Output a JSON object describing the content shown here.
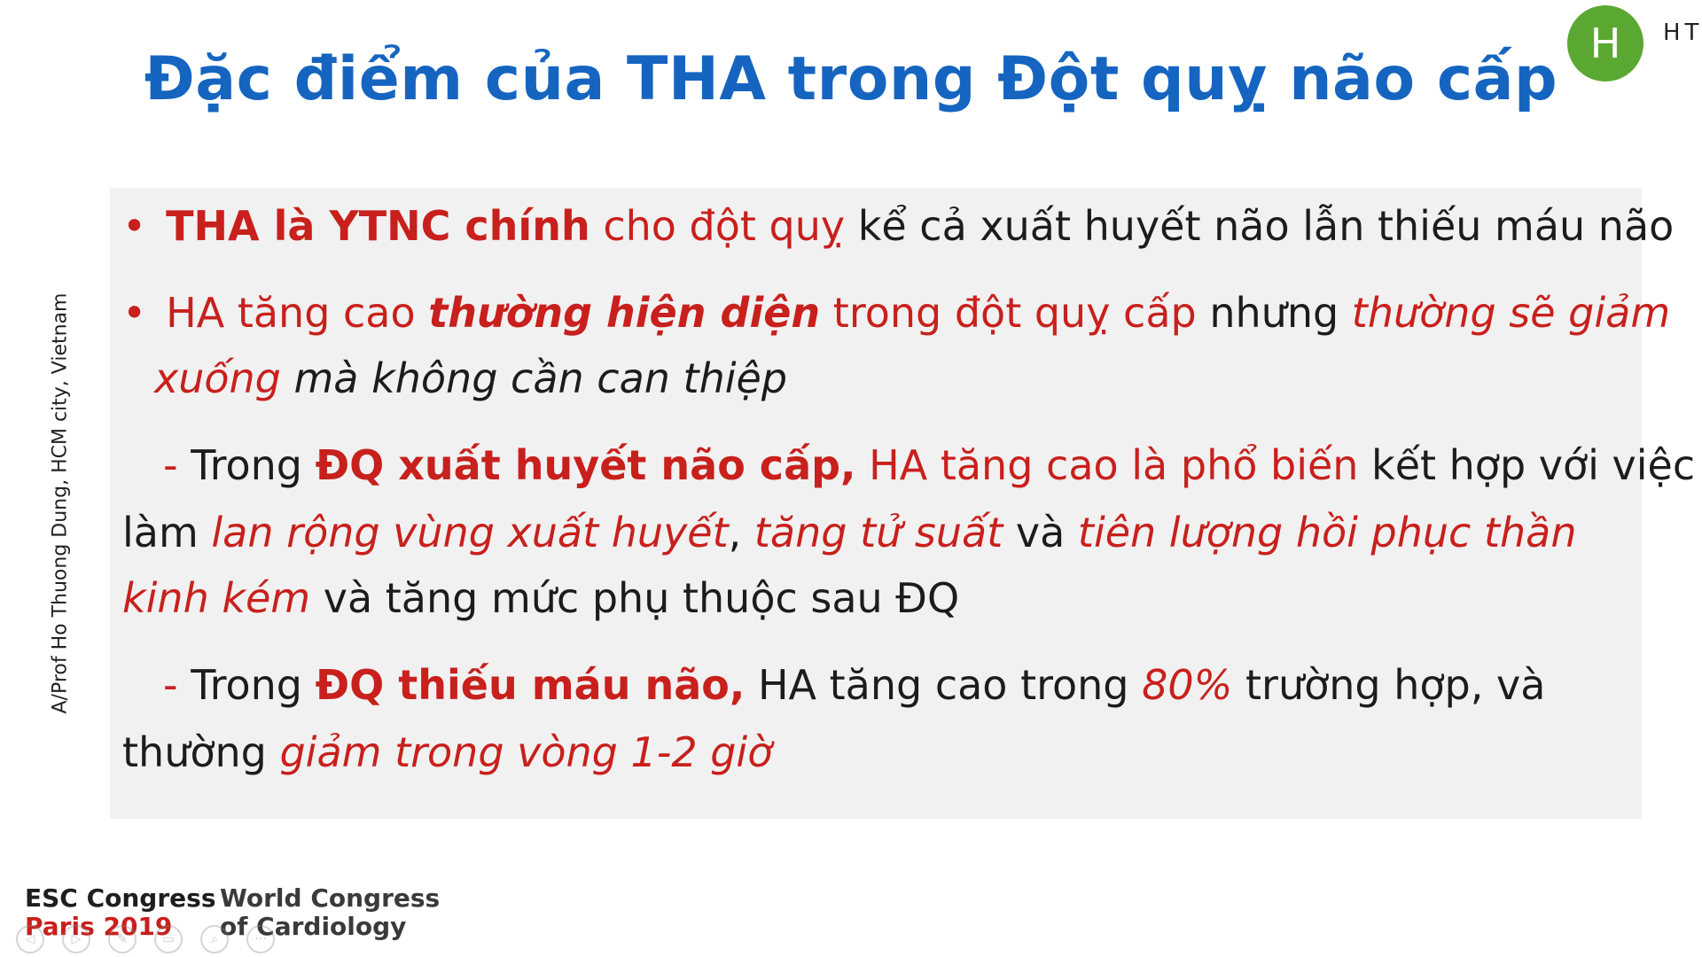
{
  "slide": {
    "title": "Đặc điểm của THA trong Đột quỵ não cấp",
    "presenter": {
      "avatar_letter": "H",
      "initials": "HT"
    },
    "vertical_credit": "A/Prof Ho Thuong Dung, HCM city, Vietnam",
    "bullets": [
      {
        "symbol": "•",
        "runs": [
          {
            "text": "THA là YTNC chính",
            "style": "red bold"
          },
          {
            "text": " cho đột quỵ",
            "style": "red"
          },
          {
            "text": " kể cả xuất huyết não lẫn thiếu máu não",
            "style": ""
          }
        ]
      },
      {
        "symbol": "•",
        "line1": [
          {
            "text": "HA tăng cao ",
            "style": "red"
          },
          {
            "text": "thường hiện diện",
            "style": "red bold it"
          },
          {
            "text": " trong đột quỵ cấp",
            "style": "red"
          },
          {
            "text": " nhưng ",
            "style": ""
          },
          {
            "text": "thường sẽ giảm",
            "style": "red it"
          }
        ],
        "line2": [
          {
            "text": "xuống",
            "style": "red it"
          },
          {
            "text": " mà không cần can thiệp",
            "style": "it"
          }
        ]
      }
    ],
    "sub_points": [
      {
        "line1": [
          {
            "text": "- ",
            "style": "red"
          },
          {
            "text": "Trong ",
            "style": ""
          },
          {
            "text": "ĐQ xuất huyết não cấp,",
            "style": "red bold"
          },
          {
            "text": " HA tăng cao là phổ biến",
            "style": "red"
          },
          {
            "text": " kết hợp với việc",
            "style": ""
          }
        ],
        "line2": [
          {
            "text": "làm ",
            "style": ""
          },
          {
            "text": "lan rộng vùng xuất huyết",
            "style": "red it"
          },
          {
            "text": ", ",
            "style": ""
          },
          {
            "text": "tăng tử suất",
            "style": "red it"
          },
          {
            "text": " và ",
            "style": ""
          },
          {
            "text": "tiên lượng hồi phục thần",
            "style": "red it"
          }
        ],
        "line3": [
          {
            "text": "kinh kém",
            "style": "red it"
          },
          {
            "text": " và tăng mức phụ thuộc sau ĐQ",
            "style": ""
          }
        ]
      },
      {
        "line1": [
          {
            "text": "- ",
            "style": "red"
          },
          {
            "text": "Trong ",
            "style": ""
          },
          {
            "text": "ĐQ thiếu máu não,",
            "style": "red bold"
          },
          {
            "text": " HA tăng cao trong ",
            "style": ""
          },
          {
            "text": "80%",
            "style": "red it"
          },
          {
            "text": " trường hợp, và",
            "style": ""
          }
        ],
        "line2": [
          {
            "text": "thường ",
            "style": ""
          },
          {
            "text": "giảm trong vòng 1-2 giờ",
            "style": "red it"
          }
        ]
      }
    ],
    "footer": {
      "esc_line1": "ESC Congress",
      "esc_line2": "Paris 2019",
      "wcc_line1": "World Congress",
      "wcc_line2": "of Cardiology"
    }
  },
  "player": {
    "controls": [
      {
        "name": "prev-icon",
        "glyph": "◁"
      },
      {
        "name": "next-icon",
        "glyph": "▷"
      },
      {
        "name": "pen-icon",
        "glyph": "✎"
      },
      {
        "name": "slides-icon",
        "glyph": "▭"
      },
      {
        "name": "zoom-icon",
        "glyph": "⌕"
      },
      {
        "name": "more-icon",
        "glyph": "···"
      }
    ]
  }
}
